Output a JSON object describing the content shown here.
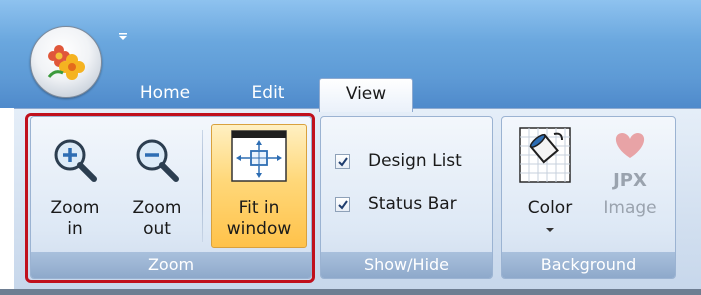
{
  "tabs": [
    {
      "label": "Home",
      "active": false
    },
    {
      "label": "Edit",
      "active": false
    },
    {
      "label": "View",
      "active": true
    }
  ],
  "groups": {
    "zoom": {
      "label": "Zoom",
      "buttons": {
        "zoom_in": {
          "line1": "Zoom",
          "line2": "in",
          "icon": "zoom-in-icon"
        },
        "zoom_out": {
          "line1": "Zoom",
          "line2": "out",
          "icon": "zoom-out-icon"
        },
        "fit_in_window": {
          "line1": "Fit in",
          "line2": "window",
          "icon": "fit-in-window-icon",
          "selected": true
        }
      }
    },
    "show_hide": {
      "label": "Show/Hide",
      "checkboxes": [
        {
          "label": "Design List",
          "checked": true
        },
        {
          "label": "Status Bar",
          "checked": true
        }
      ]
    },
    "background": {
      "label": "Background",
      "buttons": {
        "color": {
          "label": "Color",
          "icon": "paint-bucket-icon"
        },
        "image": {
          "label": "Image",
          "badge": "JPX",
          "icon": "heart-jpx-icon",
          "enabled": false
        }
      }
    }
  },
  "colors": {
    "highlight_frame": "#c0101c",
    "selected_button": "#ffc24a",
    "title_bar": "#6aa7de"
  }
}
